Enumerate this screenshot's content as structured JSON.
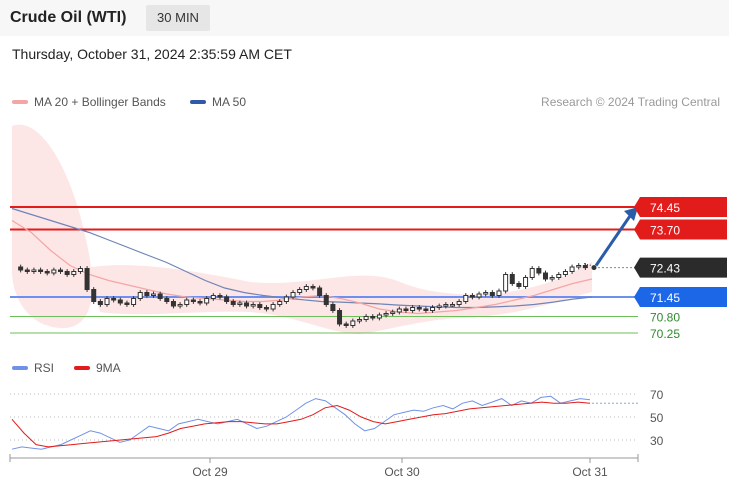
{
  "header": {
    "title": "Crude Oil (WTI)",
    "timeframe": "30 MIN"
  },
  "datetime": "Thursday, October 31, 2024 2:35:59 AM CET",
  "credit": "Research © 2024 Trading Central",
  "colors": {
    "bollinger": "#f4a5a5",
    "bollinger_fill": "#fde3e3",
    "ma50": "#6f84b8",
    "resistance": "#e21b1b",
    "support_blue": "#6c8ff0",
    "support_green": "#6cbf5a",
    "last_price": "#2b2b2b",
    "arrow": "#2a5caa",
    "rsi": "#6f92e8",
    "rsi_ma": "#e21b1b"
  },
  "chart_data": [
    {
      "type": "line",
      "title": "Crude Oil (WTI) 30 MIN",
      "legend": [
        {
          "name": "MA 20 + Bollinger Bands",
          "color": "#f4a5a5"
        },
        {
          "name": "MA 50",
          "color": "#2e5aa8"
        }
      ],
      "x_ticks": [
        "Oct 29",
        "Oct 30",
        "Oct 31"
      ],
      "levels": [
        {
          "label": "74.45",
          "value": 74.45,
          "kind": "resistance"
        },
        {
          "label": "73.70",
          "value": 73.7,
          "kind": "resistance"
        },
        {
          "label": "72.43",
          "value": 72.43,
          "kind": "last"
        },
        {
          "label": "71.45",
          "value": 71.45,
          "kind": "support-blue"
        },
        {
          "label": "70.80",
          "value": 70.8,
          "kind": "support-green"
        },
        {
          "label": "70.25",
          "value": 70.25,
          "kind": "support-green"
        }
      ],
      "price_series": [
        72.45,
        72.35,
        72.3,
        72.35,
        72.3,
        72.25,
        72.35,
        72.3,
        72.2,
        72.3,
        72.4,
        71.7,
        71.3,
        71.2,
        71.4,
        71.35,
        71.25,
        71.2,
        71.4,
        71.6,
        71.5,
        71.55,
        71.4,
        71.3,
        71.15,
        71.2,
        71.35,
        71.3,
        71.25,
        71.4,
        71.5,
        71.45,
        71.3,
        71.2,
        71.25,
        71.15,
        71.2,
        71.1,
        71.05,
        71.2,
        71.3,
        71.45,
        71.6,
        71.7,
        71.8,
        71.75,
        71.5,
        71.2,
        71.0,
        70.55,
        70.5,
        70.65,
        70.7,
        70.8,
        70.75,
        70.85,
        70.9,
        70.95,
        71.05,
        71.0,
        71.1,
        71.05,
        71.0,
        71.1,
        71.15,
        71.2,
        71.2,
        71.3,
        71.5,
        71.45,
        71.55,
        71.6,
        71.5,
        71.65,
        72.2,
        71.9,
        71.8,
        72.1,
        72.4,
        72.25,
        72.05,
        72.1,
        72.2,
        72.3,
        72.45,
        72.5,
        72.43
      ],
      "ma50_series": [
        74.4,
        74.2,
        74.0,
        73.8,
        73.6,
        73.35,
        73.1,
        72.85,
        72.6,
        72.3,
        72.0,
        71.75,
        71.6,
        71.5,
        71.42,
        71.36,
        71.3,
        71.28,
        71.25,
        71.22,
        71.18,
        71.15,
        71.12,
        71.1,
        71.1,
        71.12,
        71.15,
        71.2,
        71.28,
        71.38,
        71.45
      ],
      "ma20_series": [
        74.0,
        73.6,
        73.0,
        72.5,
        72.2,
        72.0,
        71.85,
        71.7,
        71.55,
        71.45,
        71.4,
        71.35,
        71.3,
        71.3,
        71.35,
        71.45,
        71.5,
        71.4,
        71.25,
        71.05,
        70.95,
        70.9,
        70.95,
        71.0,
        71.1,
        71.2,
        71.35,
        71.5,
        71.7,
        71.9,
        72.05
      ]
    },
    {
      "type": "line",
      "legend": [
        {
          "name": "RSI",
          "color": "#6f92e8"
        },
        {
          "name": "9MA",
          "color": "#e21b1b"
        }
      ],
      "y_ticks": [
        "70",
        "50",
        "30"
      ],
      "ylim": [
        20,
        80
      ],
      "rsi_series": [
        22,
        24,
        23,
        22,
        24,
        26,
        30,
        34,
        38,
        36,
        32,
        28,
        30,
        36,
        42,
        40,
        38,
        44,
        46,
        48,
        46,
        44,
        46,
        48,
        44,
        40,
        42,
        46,
        50,
        56,
        62,
        66,
        64,
        58,
        52,
        44,
        38,
        40,
        46,
        52,
        54,
        56,
        55,
        58,
        60,
        57,
        62,
        64,
        60,
        63,
        66,
        60,
        64,
        62,
        67,
        68,
        62,
        64,
        66,
        65
      ],
      "rsi_ma_series": [
        48,
        36,
        26,
        24,
        25,
        26,
        27,
        28,
        29,
        30,
        31,
        32,
        33,
        36,
        40,
        42,
        44,
        45,
        46,
        46,
        45,
        44,
        44,
        46,
        48,
        52,
        58,
        60,
        56,
        50,
        46,
        44,
        46,
        48,
        50,
        52,
        53,
        55,
        57,
        58,
        59,
        60,
        61,
        62,
        63,
        62,
        62,
        63,
        62
      ]
    }
  ]
}
